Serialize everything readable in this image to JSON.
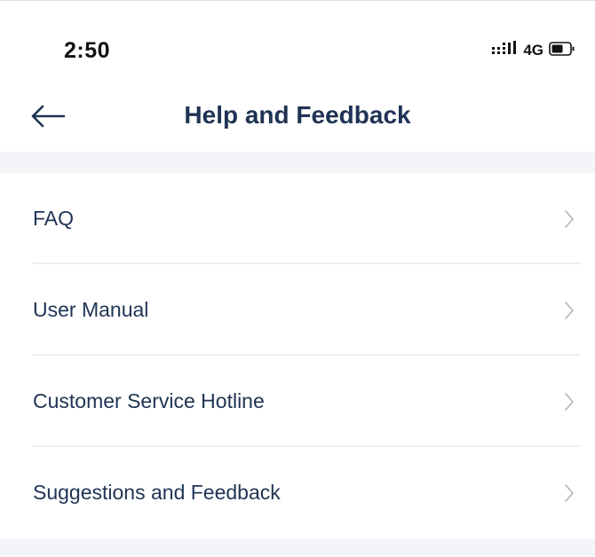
{
  "status_bar": {
    "time": "2:50",
    "network": "4G",
    "icons": [
      "signal-icon",
      "battery-icon"
    ]
  },
  "nav": {
    "title": "Help and Feedback",
    "back_icon": "arrow-left-icon"
  },
  "menu": {
    "items": [
      {
        "label": "FAQ",
        "icon": "chevron-right-icon"
      },
      {
        "label": "User Manual",
        "icon": "chevron-right-icon"
      },
      {
        "label": "Customer Service Hotline",
        "icon": "chevron-right-icon"
      },
      {
        "label": "Suggestions and Feedback",
        "icon": "chevron-right-icon"
      }
    ]
  },
  "colors": {
    "text_primary": "#1f3354",
    "separator_band": "#f4f5f8",
    "divider": "#ebedf1",
    "chevron": "#b9bdc5"
  }
}
